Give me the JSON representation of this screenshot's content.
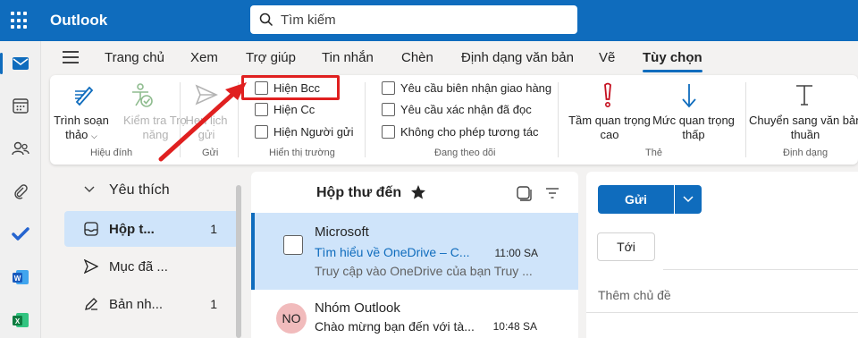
{
  "app": {
    "title": "Outlook"
  },
  "search": {
    "placeholder": "Tìm kiếm"
  },
  "colors": {
    "brand": "#0f6cbd",
    "selected": "#cfe4fa",
    "highlight": "#e02020"
  },
  "rail": {
    "items": [
      {
        "icon": "mail-icon",
        "active": true
      },
      {
        "icon": "calendar-icon"
      },
      {
        "icon": "people-icon"
      },
      {
        "icon": "attachment-icon"
      },
      {
        "icon": "todo-icon"
      },
      {
        "icon": "word-icon"
      },
      {
        "icon": "excel-icon"
      }
    ]
  },
  "tabs": [
    {
      "label": "Trang chủ"
    },
    {
      "label": "Xem"
    },
    {
      "label": "Trợ giúp"
    },
    {
      "label": "Tin nhắn"
    },
    {
      "label": "Chèn"
    },
    {
      "label": "Định dạng văn bản"
    },
    {
      "label": "Vẽ"
    },
    {
      "label": "Tùy chọn",
      "active": true
    }
  ],
  "ribbon": {
    "groups": {
      "proofing": "Hiệu đính",
      "send": "Gửi",
      "show_fields": "Hiển thị trường",
      "tracking": "Đang theo dõi",
      "tags": "Thẻ",
      "format": "Định dạng"
    },
    "editor": {
      "line1": "Trình soạn",
      "line2": "thảo"
    },
    "accessibility": {
      "line1": "Kiểm tra Trợ",
      "line2": "năng"
    },
    "delay_send": {
      "line1": "Hẹn lịch",
      "line2": "gửi"
    },
    "show_bcc": "Hiện Bcc",
    "show_cc": "Hiện Cc",
    "show_from": "Hiện Người gửi",
    "request_delivery": "Yêu cầu biên nhận giao hàng",
    "request_read": "Yêu cầu xác nhận đã đọc",
    "disallow_reactions": "Không cho phép tương tác",
    "high_importance": {
      "line1": "Tầm quan trọng",
      "line2": "cao"
    },
    "low_importance": {
      "line1": "Mức quan trọng",
      "line2": "thấp"
    },
    "switch_format": {
      "line1": "Chuyển sang văn bản",
      "line2": "thuần"
    }
  },
  "folders": {
    "header": "Yêu thích",
    "items": [
      {
        "name": "Hộp t...",
        "count": "1",
        "icon": "inbox-icon",
        "selected": true
      },
      {
        "name": "Mục đã ...",
        "count": "",
        "icon": "send-icon"
      },
      {
        "name": "Bản nh...",
        "count": "1",
        "icon": "draft-icon"
      }
    ]
  },
  "message_list": {
    "title": "Hộp thư đến",
    "messages": [
      {
        "sender": "Microsoft",
        "subject": "Tìm hiểu về OneDrive – C...",
        "time": "11:00 SA",
        "preview": "Truy cập vào OneDrive của bạn Truy ...",
        "selected": true
      },
      {
        "sender": "Nhóm Outlook",
        "avatar": "NO",
        "subject": "Chào mừng bạn đến với tà...",
        "time": "10:48 SA"
      }
    ]
  },
  "compose": {
    "send_label": "Gửi",
    "to_label": "Tới",
    "subject_placeholder": "Thêm chủ đề"
  }
}
